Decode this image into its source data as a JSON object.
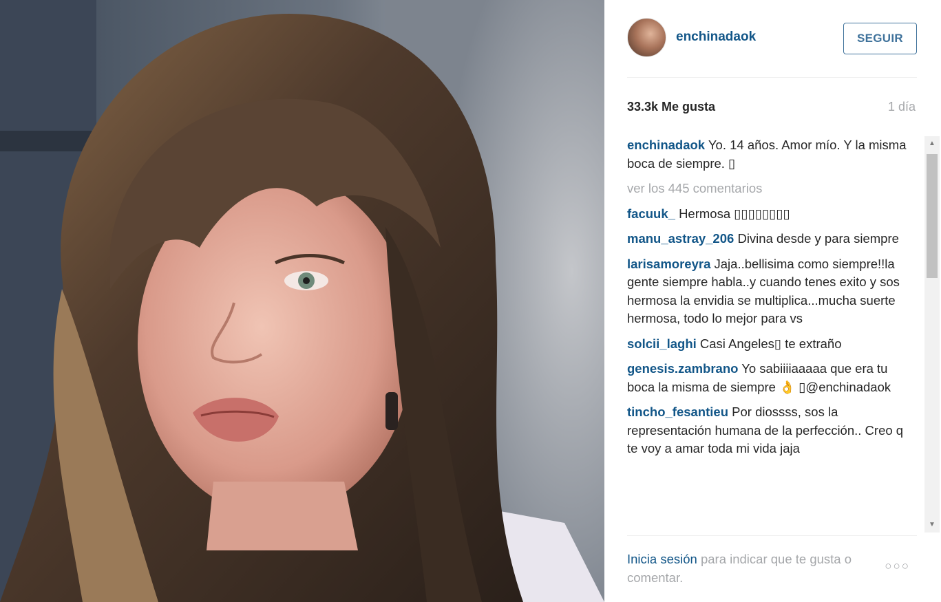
{
  "post": {
    "username": "enchinadaok",
    "follow_label": "SEGUIR",
    "likes": "33.3k Me gusta",
    "age": "1 día",
    "caption": {
      "user": "enchinadaok",
      "text": "Yo. 14 años. Amor mío. Y la misma boca de siempre. ▯"
    },
    "load_more": "ver los 445 comentarios",
    "comments": [
      {
        "user": "facuuk_",
        "text": "Hermosa ▯▯▯▯▯▯▯▯"
      },
      {
        "user": "manu_astray_206",
        "text": "Divina desde y para siempre"
      },
      {
        "user": "larisamoreyra",
        "text": "Jaja..bellisima como siempre!!la gente siempre habla..y cuando tenes exito y sos hermosa la envidia se multiplica...mucha suerte hermosa, todo lo mejor para vs"
      },
      {
        "user": "solcii_laghi",
        "text": "Casi Angeles▯ te extraño"
      },
      {
        "user": "genesis.zambrano",
        "text": "Yo sabiiiiaaaaa que era tu boca la misma de siempre 👌 ▯@enchinadaok"
      },
      {
        "user": "tincho_fesantieu",
        "text": "Por diossss, sos la representación humana de la perfección.. Creo q te voy a amar toda mi vida jaja"
      }
    ],
    "footer": {
      "login_link": "Inicia sesión",
      "rest": " para indicar que te gusta o comentar."
    },
    "more_options": "○○○"
  },
  "colors": {
    "link": "#125688",
    "follow_border": "#3f729b",
    "muted": "#a5a7aa",
    "text": "#262626"
  },
  "icons": {
    "scroll_up": "scroll-up-icon",
    "scroll_down": "scroll-down-icon",
    "more": "more-options-icon"
  }
}
